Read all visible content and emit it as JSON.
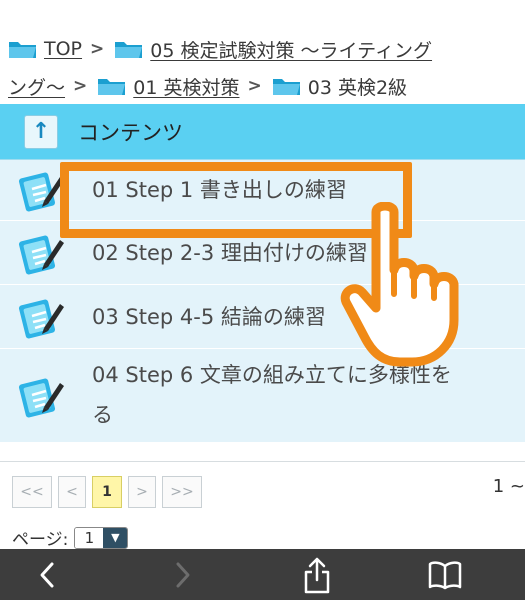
{
  "breadcrumb": {
    "items": [
      {
        "label": "TOP",
        "link": true
      },
      {
        "label": "05 検定試験対策 ～ライティング",
        "link": true
      },
      {
        "label": "ング～",
        "link": true
      },
      {
        "label": "01 英検対策",
        "link": true
      },
      {
        "label": "03 英検2級",
        "link": false
      }
    ]
  },
  "table": {
    "header": "コンテンツ",
    "up_icon": "↑",
    "rows": [
      {
        "title": "01 Step 1 書き出しの練習",
        "icon": "pencil-note-icon"
      },
      {
        "title": "02 Step 2-3 理由付けの練習",
        "icon": "pencil-note-icon"
      },
      {
        "title": "03 Step 4-5 結論の練習",
        "icon": "pencil-note-icon"
      },
      {
        "title": "04 Step 6 文章の組み立てに多様性を",
        "title_cont": "る",
        "icon": "pencil-note-icon"
      }
    ]
  },
  "pager": {
    "first": "<<",
    "prev": "<",
    "current": "1",
    "next": ">",
    "last": ">>",
    "range": "1 ~",
    "page_label": "ページ:",
    "page_value": "1",
    "page_arrow": "▼"
  },
  "toolbar": {
    "buttons": [
      "back-icon",
      "forward-icon",
      "share-icon",
      "bookmarks-icon"
    ]
  },
  "annotation": {
    "highlight_color": "#f08a17"
  }
}
